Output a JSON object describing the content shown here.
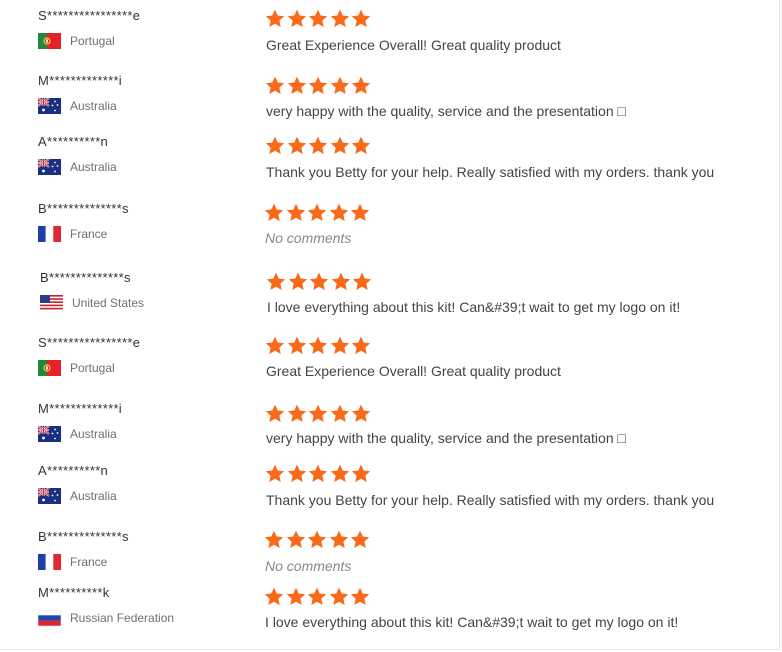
{
  "reviews": [
    {
      "name": "S****************e",
      "country": "Portugal",
      "flag": "pt",
      "rating": 5,
      "comment": "Great Experience Overall! Great quality product",
      "empty": false
    },
    {
      "name": "M*************i",
      "country": "Australia",
      "flag": "au",
      "rating": 5,
      "comment": "very happy with the quality, service and the presentation □",
      "empty": false
    },
    {
      "name": "A**********n",
      "country": "Australia",
      "flag": "au",
      "rating": 5,
      "comment": "Thank you Betty for your help. Really satisfied with my orders. thank you",
      "empty": false
    },
    {
      "name": "B**************s",
      "country": "France",
      "flag": "fr",
      "rating": 5,
      "comment": "No comments",
      "empty": true
    },
    {
      "name": "B**************s",
      "country": "United States",
      "flag": "us",
      "rating": 5,
      "comment": "I love everything about this kit! Can&#39;t wait to get my logo on it!",
      "empty": false
    },
    {
      "name": "S****************e",
      "country": "Portugal",
      "flag": "pt",
      "rating": 5,
      "comment": "Great Experience Overall! Great quality product",
      "empty": false
    },
    {
      "name": "M*************i",
      "country": "Australia",
      "flag": "au",
      "rating": 5,
      "comment": "very happy with the quality, service and the presentation □",
      "empty": false
    },
    {
      "name": "A**********n",
      "country": "Australia",
      "flag": "au",
      "rating": 5,
      "comment": "Thank you Betty for your help. Really satisfied with my orders. thank you",
      "empty": false
    },
    {
      "name": "B**************s",
      "country": "France",
      "flag": "fr",
      "rating": 5,
      "comment": "No comments",
      "empty": true
    },
    {
      "name": "M**********k",
      "country": "Russian Federation",
      "flag": "ru",
      "rating": 5,
      "comment": "I love everything about this kit! Can&#39;t wait to get my logo on it!",
      "empty": false
    }
  ],
  "colors": {
    "star": "#f96b1b",
    "text": "#444444",
    "muted": "#707070",
    "empty_comment": "#888888"
  }
}
